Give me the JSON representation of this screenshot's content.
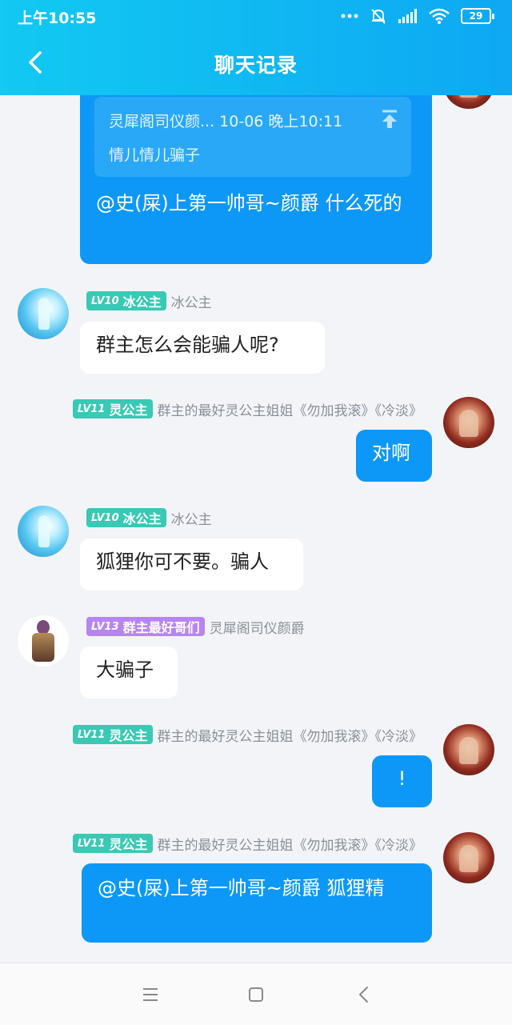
{
  "status_bar": {
    "time": "上午10:55",
    "battery": "29"
  },
  "header": {
    "title": "聊天记录"
  },
  "messages": [
    {
      "reply": {
        "head": "灵犀阁司仪颜... 10-06 晚上10:11",
        "text": "情儿情儿骗子"
      },
      "text": "@史(屎)上第一帅哥~颜爵 什么死的"
    },
    {
      "level": "LV10",
      "badge": "冰公主",
      "sender": "冰公主",
      "text": "群主怎么会能骗人呢?"
    },
    {
      "level": "LV11",
      "badge": "灵公主",
      "sender": "群主的最好灵公主姐姐《勿加我滚》《冷淡》",
      "text": "对啊"
    },
    {
      "level": "LV10",
      "badge": "冰公主",
      "sender": "冰公主",
      "text": "狐狸你可不要。骗人"
    },
    {
      "level": "LV13",
      "badge": "群主最好哥们",
      "sender": "灵犀阁司仪颜爵",
      "text": "大骗子"
    },
    {
      "level": "LV11",
      "badge": "灵公主",
      "sender": "群主的最好灵公主姐姐《勿加我滚》《冷淡》",
      "text": "!"
    },
    {
      "level": "LV11",
      "badge": "灵公主",
      "sender": "群主的最好灵公主姐姐《勿加我滚》《冷淡》",
      "text": "@史(屎)上第一帅哥~颜爵 狐狸精"
    }
  ],
  "colors": {
    "header": "#0ea8f3",
    "outgoing_bubble": "#0d98f7",
    "badge_teal": "#39c9b4",
    "badge_purple": "#b785f2"
  }
}
